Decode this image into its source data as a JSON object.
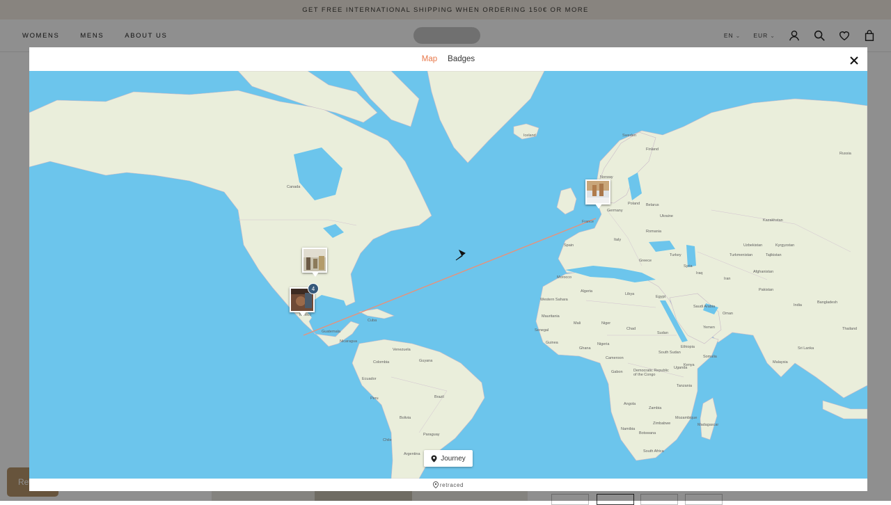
{
  "promo": {
    "text": "GET FREE INTERNATIONAL SHIPPING WHEN ORDERING 150€ OR MORE"
  },
  "header": {
    "nav": [
      "WOMENS",
      "MENS",
      "ABOUT US"
    ],
    "language": "EN",
    "currency": "EUR",
    "icons": [
      "account-icon",
      "search-icon",
      "wishlist-icon",
      "cart-icon"
    ]
  },
  "reviews_tab": {
    "label": "Rev"
  },
  "modal": {
    "tabs": [
      {
        "label": "Map",
        "active": true
      },
      {
        "label": "Badges",
        "active": false
      }
    ],
    "close_icon": "close-icon",
    "journey_button": {
      "label": "Journey",
      "icon": "location-pin-icon"
    },
    "footer": {
      "brand": "retraced",
      "icon": "location-pin-icon"
    }
  },
  "map": {
    "labels": [
      "Canada",
      "Russia",
      "Sweden",
      "Finland",
      "Poland",
      "Ukraine",
      "Kazakhstan",
      "Uzbekistan",
      "Kyrgyzstan",
      "Turkmenistan",
      "Tajikistan",
      "Afghanistan",
      "Pakistan",
      "India",
      "Bangladesh",
      "Thailand",
      "Malaysia",
      "Sri Lanka",
      "Iran",
      "Iraq",
      "Syria",
      "Turkey",
      "Saudi Arabia",
      "Yemen",
      "Oman",
      "Egypt",
      "Libya",
      "Algeria",
      "Morocco",
      "Mauritania",
      "Mali",
      "Niger",
      "Chad",
      "Sudan",
      "Nigeria",
      "Cameroon",
      "Ethiopia",
      "South Sudan",
      "Somalia",
      "Kenya",
      "Tanzania",
      "Democratic Republic of the Congo",
      "Angola",
      "Zambia",
      "Zimbabwe",
      "Mozambique",
      "Madagascar",
      "Namibia",
      "Botswana",
      "South Africa",
      "Spain",
      "France",
      "Germany",
      "Italy",
      "Romania",
      "Iceland",
      "Colombia",
      "Venezuela",
      "Peru",
      "Brazil",
      "Bolivia",
      "Chile",
      "Argentina",
      "Paraguay",
      "Guyana",
      "Norway",
      "Belarus",
      "Greece",
      "Cuba",
      "Mexico",
      "Guatemala",
      "Nicaragua",
      "Ecuador",
      "Senegal",
      "Guinea",
      "Ghana",
      "Gabon",
      "Uganda",
      "Western Sahara"
    ],
    "pins": [
      {
        "name": "pin-usa",
        "image": "warehouse-photo"
      },
      {
        "name": "pin-mexico",
        "image": "workshop-photo",
        "count": "4"
      },
      {
        "name": "pin-europe",
        "image": "product-photo"
      }
    ],
    "route": {
      "from": "Mexico",
      "to": "Europe",
      "direction_icon": "arrow-icon"
    }
  },
  "colors": {
    "accent": "#e8784a",
    "ocean": "#6cc5ec",
    "land": "#eaeedb",
    "route": "#e8917a",
    "badge": "#36597a"
  }
}
